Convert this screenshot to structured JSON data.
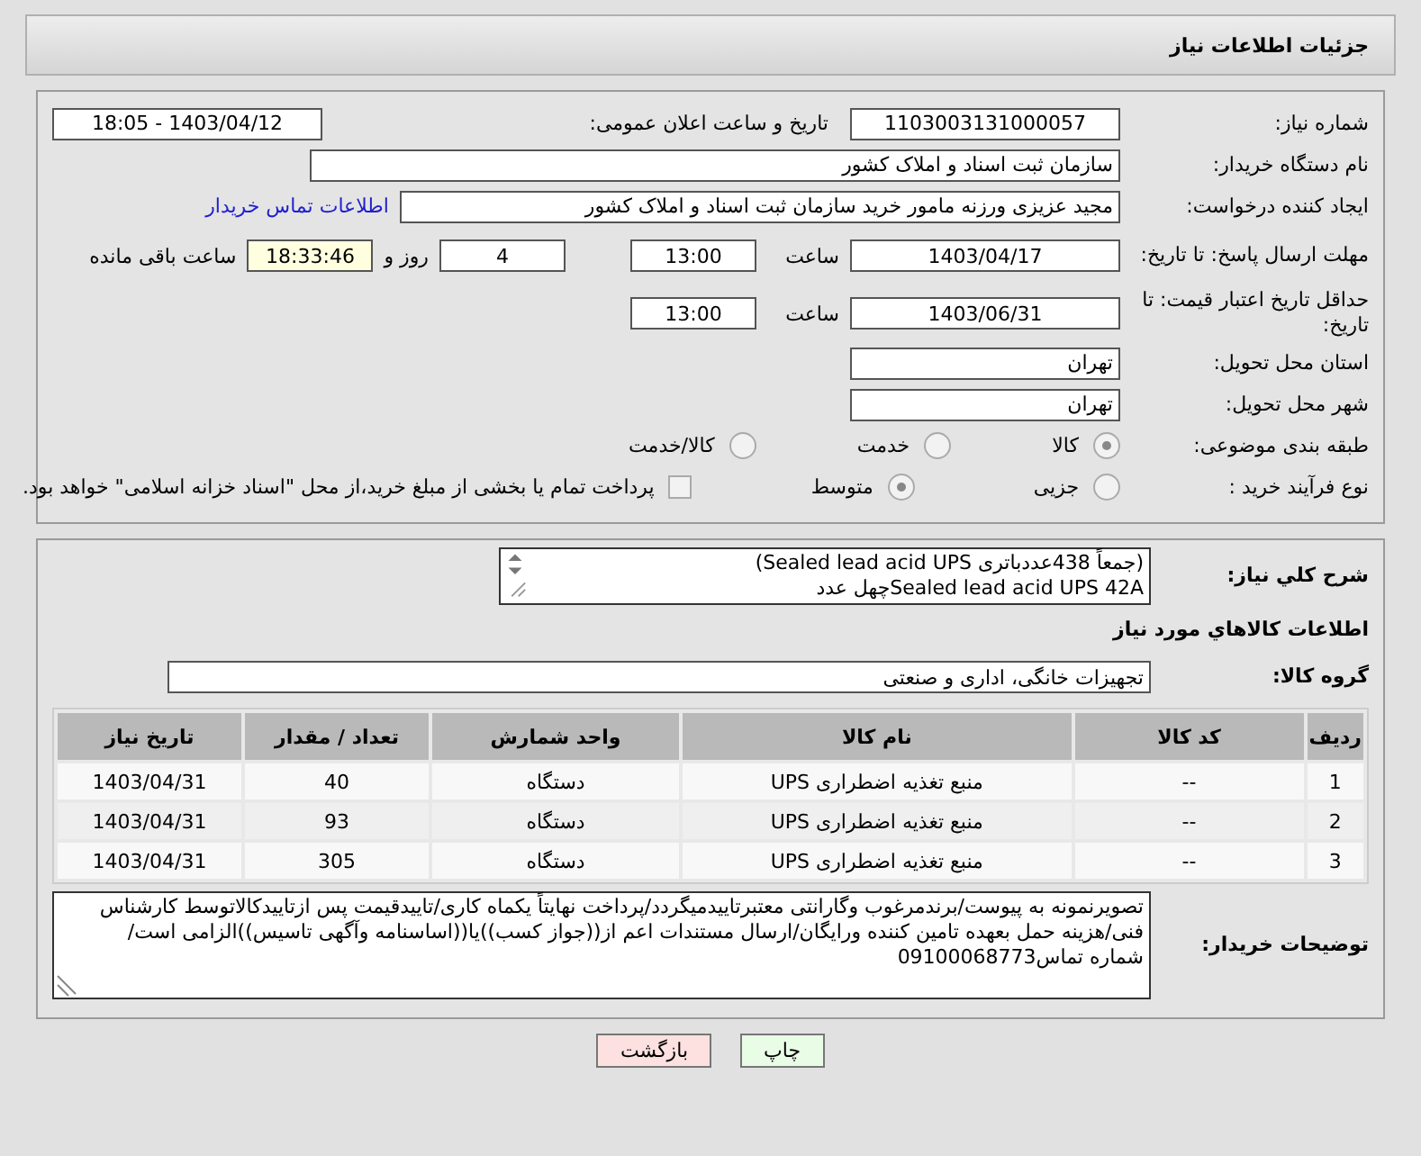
{
  "header": {
    "title": "جزئیات اطلاعات نیاز"
  },
  "need_info": {
    "need_number": {
      "label": "شماره نیاز:",
      "value": "1103003131000057"
    },
    "announce": {
      "label": "تاریخ و ساعت اعلان عمومی:",
      "value": "1403/04/12 - 18:05"
    },
    "buyer_org": {
      "label": "نام دستگاه خریدار:",
      "value": "سازمان ثبت اسناد و املاک کشور"
    },
    "creator": {
      "label": "ایجاد کننده درخواست:",
      "value": "مجید عزیزی ورزنه مامور خرید سازمان ثبت اسناد و املاک کشور",
      "link": "اطلاعات تماس خریدار"
    },
    "reply_deadline": {
      "label": "مهلت ارسال پاسخ: تا تاریخ:",
      "date": "1403/04/17",
      "time_label": "ساعت",
      "time": "13:00",
      "days": "4",
      "days_label": "روز و",
      "remaining": "18:33:46",
      "remaining_label": "ساعت باقی مانده"
    },
    "price_validity": {
      "label": "حداقل تاریخ اعتبار قیمت: تا تاریخ:",
      "date": "1403/06/31",
      "time_label": "ساعت",
      "time": "13:00"
    },
    "province": {
      "label": "استان محل تحویل:",
      "value": "تهران"
    },
    "city": {
      "label": "شهر محل تحویل:",
      "value": "تهران"
    },
    "category": {
      "label": "طبقه بندی موضوعی:",
      "options": [
        {
          "label": "کالا",
          "selected": true
        },
        {
          "label": "خدمت",
          "selected": false
        },
        {
          "label": "کالا/خدمت",
          "selected": false
        }
      ]
    },
    "process": {
      "label": "نوع فرآیند خرید :",
      "options": [
        {
          "label": "جزیی",
          "selected": false
        },
        {
          "label": "متوسط",
          "selected": true
        }
      ],
      "treasury": {
        "checked": false,
        "label": "پرداخت تمام یا بخشی از مبلغ خرید،از محل \"اسناد خزانه اسلامی\" خواهد بود."
      }
    }
  },
  "goods": {
    "description": {
      "label": "شرح کلي نياز:",
      "lines": [
        "(جمعاً 438عددباتری Sealed lead acid UPS)",
        "Sealed lead acid UPS 42Aچهل عدد"
      ]
    },
    "section_title": "اطلاعات کالاهاي مورد نياز",
    "group": {
      "label": "گروه کالا:",
      "value": "تجهیزات خانگی، اداری و صنعتی"
    },
    "table": {
      "columns": [
        "ردیف",
        "کد کالا",
        "نام کالا",
        "واحد شمارش",
        "تعداد / مقدار",
        "تاریخ نیاز"
      ],
      "rows": [
        [
          "1",
          "--",
          "منبع تغذیه اضطراری UPS",
          "دستگاه",
          "40",
          "1403/04/31"
        ],
        [
          "2",
          "--",
          "منبع تغذیه اضطراری UPS",
          "دستگاه",
          "93",
          "1403/04/31"
        ],
        [
          "3",
          "--",
          "منبع تغذیه اضطراری UPS",
          "دستگاه",
          "305",
          "1403/04/31"
        ]
      ]
    },
    "buyer_notes": {
      "label": "توضیحات خریدار:",
      "value": "تصویرنمونه به پیوست/برندمرغوب وگارانتی معتبرتاییدمیگردد/پرداخت نهایتاً یکماه کاری/تاییدقیمت پس ازتاییدکالاتوسط کارشناس فنی/هزینه حمل بعهده تامین کننده ورایگان/ارسال مستندات اعم از((جواز کسب))یا((اساسنامه وآگهی تاسیس))الزامی است/شماره تماس09100068773"
    }
  },
  "buttons": [
    {
      "label": "چاپ",
      "kind": "print"
    },
    {
      "label": "بازگشت",
      "kind": "back"
    }
  ]
}
